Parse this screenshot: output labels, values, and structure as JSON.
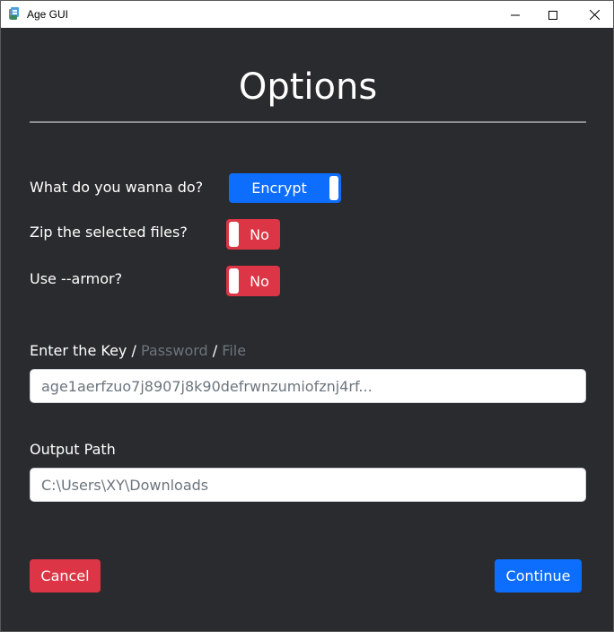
{
  "window": {
    "title": "Age GUI",
    "controls": {
      "minimize_icon": "minimize-icon",
      "maximize_icon": "maximize-icon",
      "close_icon": "close-icon"
    }
  },
  "options": {
    "heading": "Options",
    "mode": {
      "label": "What do you wanna do?",
      "value": "Encrypt"
    },
    "zip": {
      "label": "Zip the selected files?",
      "value": "No"
    },
    "armor": {
      "label": "Use --armor?",
      "value": "No"
    }
  },
  "key": {
    "label_active": "Enter the Key",
    "separator_1": "/",
    "label_password": "Password",
    "separator_2": "/",
    "label_file": "File",
    "placeholder": "age1aerfzuo7j8907j8k90defrwnzumiofznj4rf..."
  },
  "output": {
    "label": "Output Path",
    "placeholder": "C:\\Users\\XY\\Downloads"
  },
  "actions": {
    "cancel_label": "Cancel",
    "continue_label": "Continue"
  },
  "colors": {
    "background": "#2a2b2e",
    "primary": "#0d6efd",
    "danger": "#dc3545",
    "muted": "#6c757d"
  }
}
